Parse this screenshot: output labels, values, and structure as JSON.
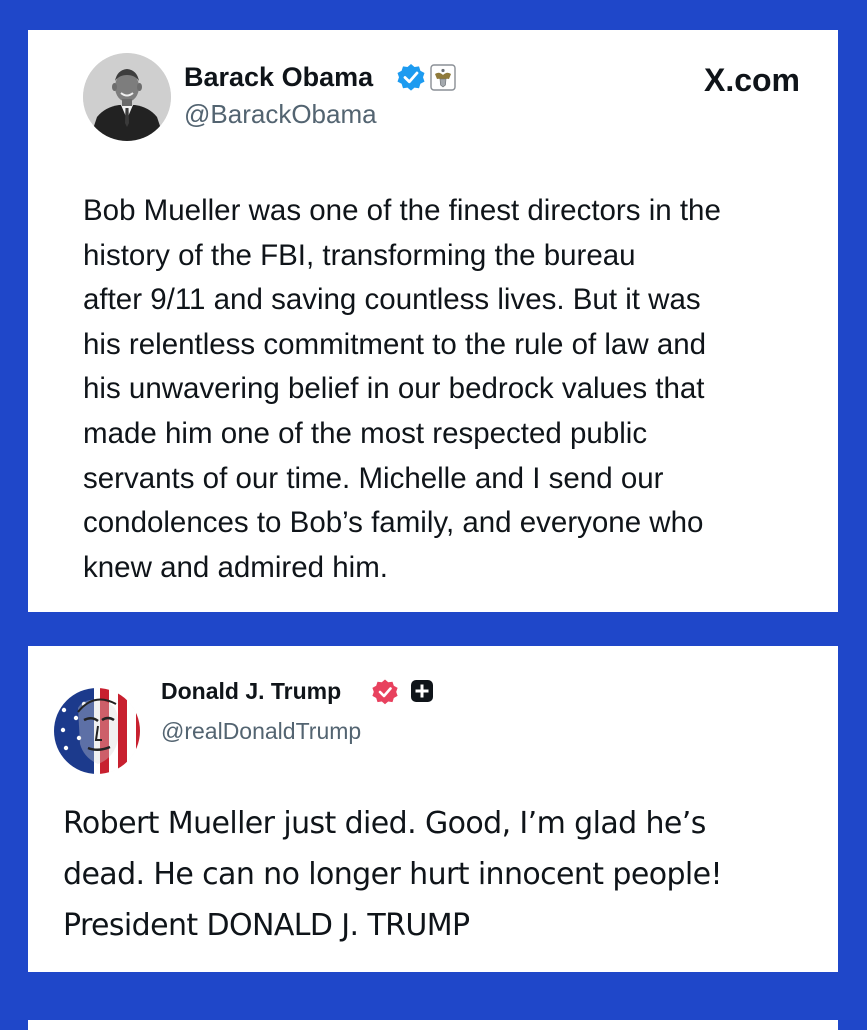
{
  "posts": [
    {
      "display_name": "Barack Obama",
      "handle": "@BarackObama",
      "brand": "X.com",
      "verified_badge": "verified-check-icon",
      "affiliation_badge": "presidential-seal-icon",
      "badge_color": "#1d9bf0",
      "body_lines": [
        "Bob Mueller was one of the finest directors in the",
        "history of the FBI, transforming the bureau",
        "after 9/11 and saving countless lives. But it was",
        "his relentless commitment to the rule of law and",
        "his unwavering belief in our bedrock values that",
        "made him one of the most respected public",
        "servants of our time. Michelle and I send our",
        "condolences to Bob’s family, and everyone who",
        "knew and admired him."
      ]
    },
    {
      "display_name": "Donald J. Trump",
      "handle": "@realDonaldTrump",
      "verified_badge": "verified-badge-icon",
      "affiliation_badge": "truth-social-plus-icon",
      "badge_color": "#e8415e",
      "body_lines": [
        "Robert Mueller just died. Good, I’m glad he’s",
        "dead. He can no longer hurt innocent people!",
        "President DONALD J. TRUMP"
      ]
    }
  ],
  "colors": {
    "background": "#1f47c9",
    "card": "#ffffff",
    "text": "#0f1419",
    "handle": "#536471"
  }
}
